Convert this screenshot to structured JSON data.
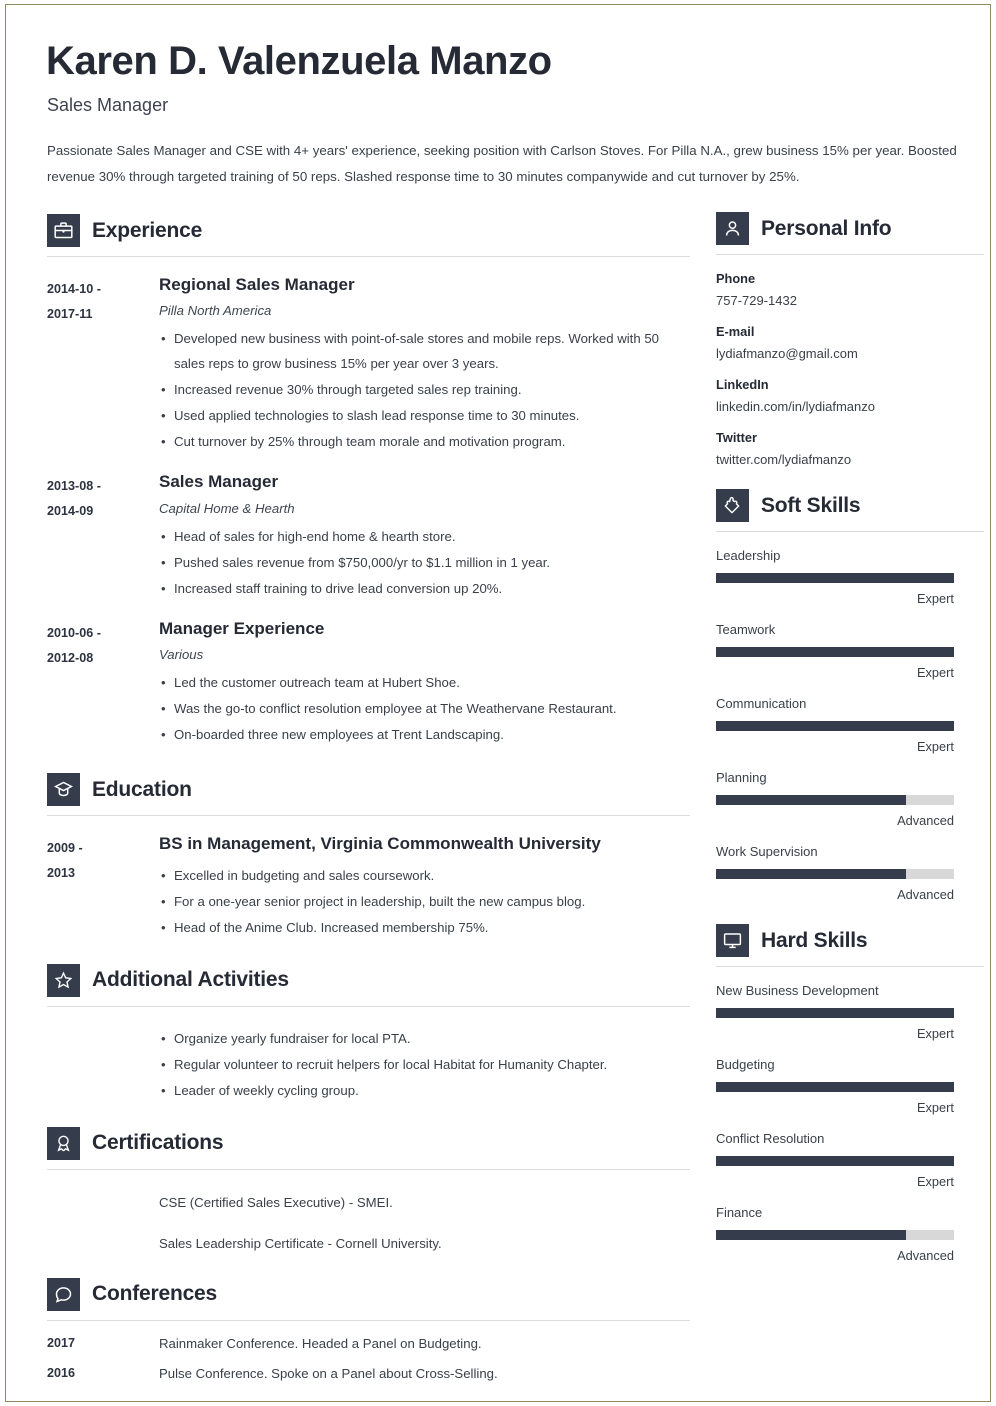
{
  "header": {
    "name": "Karen D. Valenzuela Manzo",
    "job_title": "Sales Manager",
    "summary": "Passionate Sales Manager and CSE with 4+ years' experience, seeking position with Carlson Stoves. For Pilla N.A., grew business 15% per year. Boosted revenue 30% through targeted training of 50 reps. Slashed response time to 30 minutes companywide and cut turnover by 25%."
  },
  "theme": {
    "accent_dark": "#353c4b",
    "text_dark": "#252a35",
    "text_body": "#3a4049",
    "rule": "#dcdcdc",
    "bar_track": "#d8d8d8",
    "page_border": "#8b8c5f"
  },
  "sections": {
    "experience": {
      "title": "Experience",
      "icon": "briefcase-icon",
      "entries": [
        {
          "date": "2014-10 - 2017-11",
          "date_line1": "2014-10 -",
          "date_line2": "2017-11",
          "role": "Regional Sales Manager",
          "org": "Pilla North America",
          "bullets": [
            "Developed new business with point-of-sale stores and mobile reps. Worked with 50 sales reps to grow business 15% per year over 3 years.",
            "Increased revenue 30% through targeted sales rep training.",
            "Used applied technologies to slash lead response time to 30 minutes.",
            "Cut turnover by 25% through team morale and motivation program."
          ]
        },
        {
          "date": "2013-08 - 2014-09",
          "date_line1": "2013-08 -",
          "date_line2": "2014-09",
          "role": "Sales Manager",
          "org": "Capital Home & Hearth",
          "bullets": [
            "Head of sales for high-end home & hearth store.",
            "Pushed sales revenue from $750,000/yr to $1.1 million in 1 year.",
            "Increased staff training to drive lead conversion up 20%."
          ]
        },
        {
          "date": "2010-06 - 2012-08",
          "date_line1": "2010-06 -",
          "date_line2": "2012-08",
          "role": "Manager Experience",
          "org": "Various",
          "bullets": [
            "Led the customer outreach team at Hubert Shoe.",
            "Was the go-to conflict resolution employee at The Weathervane Restaurant.",
            "On-boarded three new employees at Trent Landscaping."
          ]
        }
      ]
    },
    "education": {
      "title": "Education",
      "icon": "graduation-cap-icon",
      "entries": [
        {
          "date_line1": "2009 -",
          "date_line2": "2013",
          "degree": "BS in Management, Virginia Commonwealth University",
          "bullets": [
            "Excelled in budgeting and sales coursework.",
            "For a one-year senior project in leadership, built the new campus blog.",
            "Head of the Anime Club. Increased membership 75%."
          ]
        }
      ]
    },
    "activities": {
      "title": "Additional Activities",
      "icon": "star-icon",
      "bullets": [
        "Organize yearly fundraiser for local PTA.",
        "Regular volunteer to recruit helpers for local Habitat for Humanity Chapter.",
        "Leader of weekly cycling group."
      ]
    },
    "certifications": {
      "title": "Certifications",
      "icon": "award-ribbon-icon",
      "items": [
        "CSE (Certified Sales Executive) - SMEI.",
        "Sales Leadership Certificate - Cornell University."
      ]
    },
    "conferences": {
      "title": "Conferences",
      "icon": "speech-bubble-icon",
      "rows": [
        {
          "year": "2017",
          "text": "Rainmaker Conference. Headed a Panel on Budgeting."
        },
        {
          "year": "2016",
          "text": "Pulse Conference. Spoke on a Panel about Cross-Selling."
        }
      ]
    }
  },
  "sidebar": {
    "personal_info": {
      "title": "Personal Info",
      "icon": "person-icon",
      "fields": [
        {
          "label": "Phone",
          "value": "757-729-1432"
        },
        {
          "label": "E-mail",
          "value": "lydiafmanzo@gmail.com"
        },
        {
          "label": "LinkedIn",
          "value": "linkedin.com/in/lydiafmanzo"
        },
        {
          "label": "Twitter",
          "value": "twitter.com/lydiafmanzo"
        }
      ]
    },
    "soft_skills": {
      "title": "Soft Skills",
      "icon": "puzzle-piece-icon",
      "skills": [
        {
          "name": "Leadership",
          "level": "Expert",
          "percent": 100
        },
        {
          "name": "Teamwork",
          "level": "Expert",
          "percent": 100
        },
        {
          "name": "Communication",
          "level": "Expert",
          "percent": 100
        },
        {
          "name": "Planning",
          "level": "Advanced",
          "percent": 80
        },
        {
          "name": "Work Supervision",
          "level": "Advanced",
          "percent": 80
        }
      ]
    },
    "hard_skills": {
      "title": "Hard Skills",
      "icon": "monitor-icon",
      "skills": [
        {
          "name": "New Business Development",
          "level": "Expert",
          "percent": 100
        },
        {
          "name": "Budgeting",
          "level": "Expert",
          "percent": 100
        },
        {
          "name": "Conflict Resolution",
          "level": "Expert",
          "percent": 100
        },
        {
          "name": "Finance",
          "level": "Advanced",
          "percent": 80
        }
      ]
    }
  }
}
